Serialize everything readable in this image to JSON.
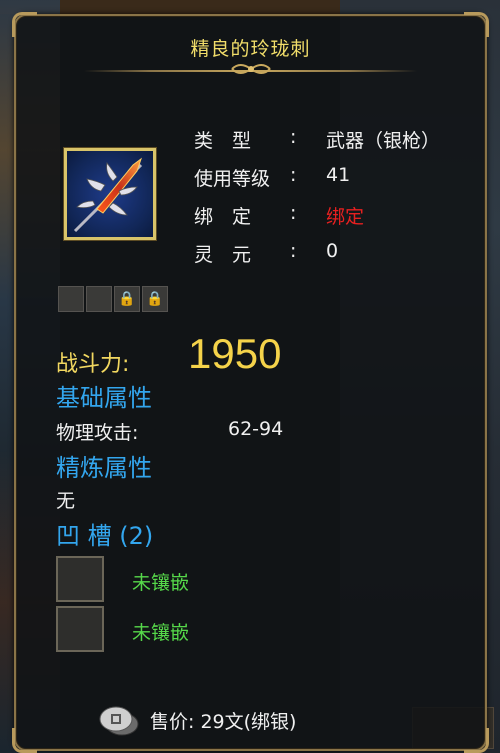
{
  "item": {
    "title": "精良的玲珑刺",
    "type_label": "类　型",
    "type_value": "武器（银枪）",
    "level_label": "使用等级",
    "level_value": "41",
    "bind_label": "绑　定",
    "bind_value": "绑定",
    "soul_label": "灵　元",
    "soul_value": "0",
    "colon": ":"
  },
  "power": {
    "label": "战斗力:",
    "value": "1950"
  },
  "base_attrs": {
    "header": "基础属性",
    "items": [
      {
        "name": "物理攻击:",
        "value": "62-94"
      }
    ]
  },
  "refine_attrs": {
    "header": "精炼属性",
    "value": "无"
  },
  "sockets": {
    "header": "凹 槽 (2)",
    "items": [
      {
        "label": "未镶嵌"
      },
      {
        "label": "未镶嵌"
      }
    ]
  },
  "price": {
    "text": "售价: 29文(绑银)"
  },
  "colors": {
    "title": "#f2de6a",
    "section": "#33a6ee",
    "bound": "#e82020",
    "empty_socket": "#56d84a",
    "power": "#f5d34a"
  },
  "icons": [
    "spear-weapon-icon",
    "lock-icon",
    "coin-icon"
  ]
}
